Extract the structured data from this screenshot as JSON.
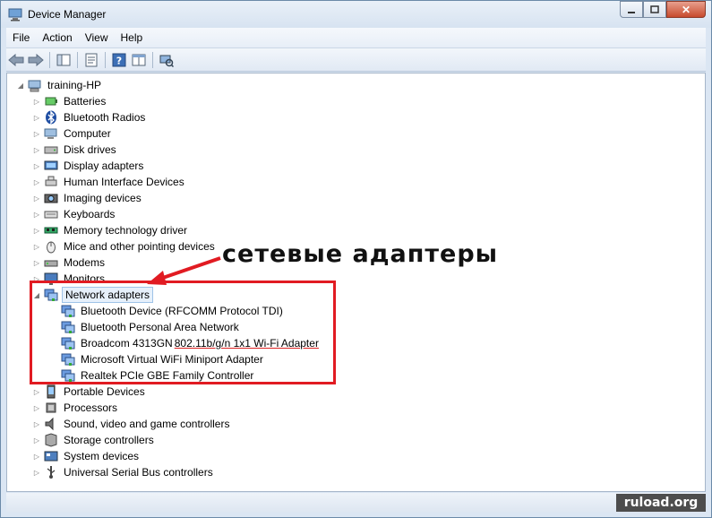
{
  "window": {
    "title": "Device Manager"
  },
  "caption": {
    "minimize": "▭",
    "maximize": "□",
    "close": "✕"
  },
  "menu": [
    "File",
    "Action",
    "View",
    "Help"
  ],
  "tree": {
    "root": "training-HP",
    "categories": [
      {
        "label": "Batteries",
        "icon": "battery-icon"
      },
      {
        "label": "Bluetooth Radios",
        "icon": "bluetooth-icon"
      },
      {
        "label": "Computer",
        "icon": "computer-icon"
      },
      {
        "label": "Disk drives",
        "icon": "disk-drive-icon"
      },
      {
        "label": "Display adapters",
        "icon": "display-adapter-icon"
      },
      {
        "label": "Human Interface Devices",
        "icon": "hid-icon"
      },
      {
        "label": "Imaging devices",
        "icon": "camera-icon"
      },
      {
        "label": "Keyboards",
        "icon": "keyboard-icon"
      },
      {
        "label": "Memory technology driver",
        "icon": "memory-icon"
      },
      {
        "label": "Mice and other pointing devices",
        "icon": "mouse-icon"
      },
      {
        "label": "Modems",
        "icon": "modem-icon"
      },
      {
        "label": "Monitors",
        "icon": "monitor-icon"
      },
      {
        "label": "Network adapters",
        "icon": "network-adapter-icon",
        "expanded": true
      },
      {
        "label": "Portable Devices",
        "icon": "portable-device-icon"
      },
      {
        "label": "Processors",
        "icon": "processor-icon"
      },
      {
        "label": "Sound, video and game controllers",
        "icon": "sound-icon"
      },
      {
        "label": "Storage controllers",
        "icon": "storage-icon"
      },
      {
        "label": "System devices",
        "icon": "system-icon"
      },
      {
        "label": "Universal Serial Bus controllers",
        "icon": "usb-icon"
      }
    ],
    "network_children": [
      "Bluetooth Device (RFCOMM Protocol TDI)",
      "Bluetooth Personal Area Network",
      "Broadcom 4313GN ",
      "Microsoft Virtual WiFi Miniport Adapter",
      "Realtek PCIe GBE Family Controller"
    ],
    "broadcom_suffix": "802.11b/g/n 1x1 Wi-Fi Adapter"
  },
  "annotation": {
    "text": "сетевые адаптеры",
    "color": "#e11b22"
  },
  "watermark": "ruload.org"
}
